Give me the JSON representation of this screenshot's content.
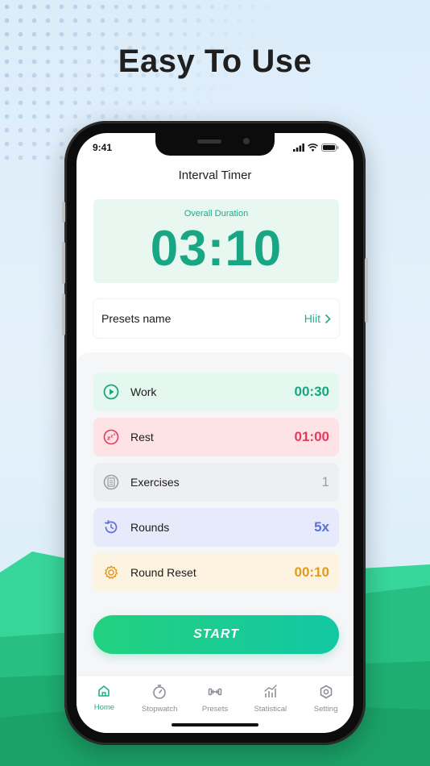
{
  "headline": "Easy To Use",
  "status": {
    "time": "9:41"
  },
  "app": {
    "title": "Interval Timer",
    "overall": {
      "label": "Overall Duration",
      "value": "03:10"
    },
    "presets": {
      "label": "Presets name",
      "value": "Hiit"
    },
    "rows": [
      {
        "label": "Work",
        "value": "00:30",
        "icon": "play-icon",
        "bg": "#e4f8ef",
        "color": "#1aa57f"
      },
      {
        "label": "Rest",
        "value": "01:00",
        "icon": "sleep-icon",
        "bg": "#fde2e6",
        "color": "#e53a5c"
      },
      {
        "label": "Exercises",
        "value": "1",
        "icon": "list-icon",
        "bg": "#eeeff1",
        "color": "#9a9ea5"
      },
      {
        "label": "Rounds",
        "value": "5x",
        "icon": "rounds-icon",
        "bg": "#e7eafb",
        "color": "#5b6fd6"
      },
      {
        "label": "Round Reset",
        "value": "00:10",
        "icon": "gear-icon",
        "bg": "#fdf3e1",
        "color": "#e19a1e"
      }
    ],
    "start_label": "START"
  },
  "tabs": [
    {
      "label": "Home",
      "icon": "home-icon",
      "active": true
    },
    {
      "label": "Stopwatch",
      "icon": "stopwatch-icon",
      "active": false
    },
    {
      "label": "Presets",
      "icon": "dumbbell-icon",
      "active": false
    },
    {
      "label": "Statistical",
      "icon": "chart-icon",
      "active": false
    },
    {
      "label": "Setting",
      "icon": "settings-icon",
      "active": false
    }
  ],
  "colors": {
    "accent": "#20b089",
    "background": "#dcecf9",
    "hill": "#2ecf8f"
  }
}
